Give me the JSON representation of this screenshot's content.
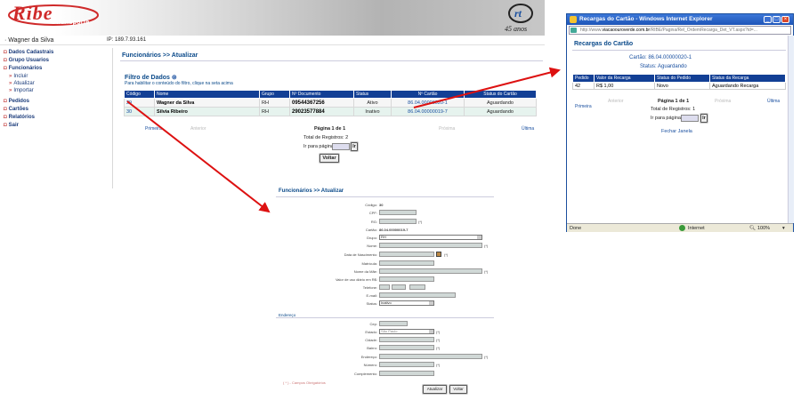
{
  "header": {
    "logo_text": "Ribe",
    "logo_subtext": "transporte",
    "anniversary_logo": "rt",
    "anniversary_text": "45 anos"
  },
  "userbar": {
    "user": "· Wagner da Silva",
    "ip": "IP: 189.7.93.161"
  },
  "sidebar": {
    "items": [
      {
        "label": "Dados Cadastrais"
      },
      {
        "label": "Grupo Usuarios"
      },
      {
        "label": "Funcionários"
      },
      {
        "label": "Incluir",
        "sub": true
      },
      {
        "label": "Atualizar",
        "sub": true
      },
      {
        "label": "Importar",
        "sub": true
      },
      {
        "label": "Pedidos"
      },
      {
        "label": "Cartões"
      },
      {
        "label": "Relatórios"
      },
      {
        "label": "Sair"
      }
    ]
  },
  "main": {
    "breadcrumb": "Funcionários  >> Atualizar",
    "filter_title": "Filtro de Dados",
    "filter_hint": "Para habilitar o conteúdo do filtro, clique na seta acima",
    "table": {
      "headers": [
        "Código",
        "Nome",
        "Grupo",
        "Nº Documento",
        "Status",
        "Nº Cartão",
        "Status do Cartão"
      ],
      "rows": [
        [
          "29",
          "Wagner da Silva",
          "RH",
          "09544367256",
          "Ativo",
          "86.04.00000020-1",
          "Aguardando"
        ],
        [
          "30",
          "Silvia Ribeiro",
          "RH",
          "29023577884",
          "Inativo",
          "86.04.00000019-7",
          "Aguardando"
        ]
      ]
    },
    "pager": {
      "first": "Primeira",
      "prev": "Anterior",
      "next": "Próxima",
      "last": "Última",
      "page": "Página 1 de 1",
      "total": "Total de Registros: 2",
      "goto_label": "Ir para página:",
      "go_button": "Ir",
      "back_button": "Voltar"
    }
  },
  "form": {
    "breadcrumb": "Funcionários  >> Atualizar",
    "codigo_label": "Código:",
    "codigo_value": "30",
    "cpf_label": "CPF:",
    "rg_label": "RG:",
    "cartao_label": "Cartão:",
    "cartao_value": "86.04.00000019-7",
    "grupo_label": "Grupo:",
    "grupo_value": "RH",
    "nome_label": "Nome:",
    "nascimento_label": "Data de Nascimento:",
    "matricula_label": "Matrícula:",
    "mae_label": "Nome da Mãe:",
    "valor_label": "Valor de uso diário em R$:",
    "telefone_label": "Telefone:",
    "email_label": "E-mail:",
    "status_label": "Status:",
    "status_value": "Inativo",
    "endereco_section": "Endereço",
    "cep_label": "Cep:",
    "estado_label": "Estado:",
    "estado_value": "São Paulo",
    "cidade_label": "Cidade:",
    "bairro_label": "Bairro:",
    "endereco_label": "Endereço:",
    "numero_label": "Número:",
    "complemento_label": "Complemento:",
    "required_mark": "(*)",
    "required_note": "( * ) - Campos Obrigatórios",
    "update_button": "Atualizar",
    "back_button": "Voltar"
  },
  "popup": {
    "window_title": "Recargas do Cartão - Windows Internet Explorer",
    "url_prefix": "http://www.",
    "url_domain": "viacaoouroverde.com.br",
    "url_rest": "/RIBE/Pagina/Rel_OrdemRecarga_Det_VT.aspx?id=...",
    "title": "Recargas do Cartão",
    "cartao": "Cartão: 86.04.00000020-1",
    "status": "Status: Aguardando",
    "table": {
      "headers": [
        "Pedido",
        "Valor da Recarga",
        "Status do Pedido",
        "Status da Recarga"
      ],
      "rows": [
        [
          "42",
          "R$ 1,00",
          "Novo",
          "Aguardando Recarga"
        ]
      ]
    },
    "pager": {
      "first": "Primeira",
      "prev": "Anterior",
      "next": "Próxima",
      "last": "Última",
      "page": "Página 1 de 1",
      "total": "Total de Registros: 1",
      "goto_label": "Ir para página:",
      "go_button": "Ir",
      "close": "Fechar Janela"
    },
    "statusbar": {
      "left": "Done",
      "zone": "Internet",
      "zoom": "100%"
    }
  },
  "colors": {
    "brand_red": "#cf2a2a",
    "header_blue": "#123f95",
    "link_blue": "#1a50a0",
    "arrow_red": "#dd1111"
  }
}
